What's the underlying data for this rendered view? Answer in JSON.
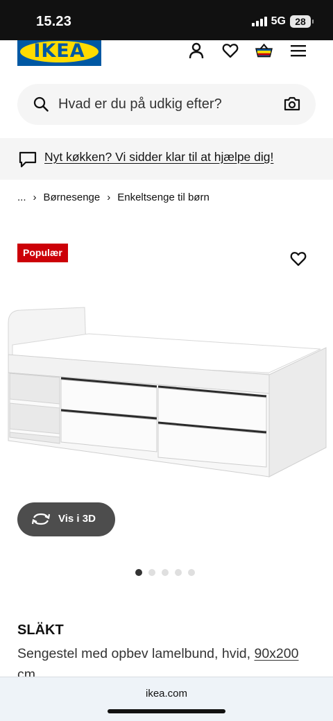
{
  "status_bar": {
    "time": "15.23",
    "network": "5G",
    "battery": "28"
  },
  "header": {
    "logo_text": "IKEA",
    "icons": [
      "user-icon",
      "heart-icon",
      "basket-icon",
      "menu-icon"
    ]
  },
  "search": {
    "placeholder": "Hvad er du på udkig efter?"
  },
  "banner": {
    "text": "Nyt køkken? Vi sidder klar til at hjælpe dig!"
  },
  "breadcrumb": {
    "items": [
      "...",
      "Børnesenge",
      "Enkeltsenge til børn"
    ]
  },
  "product": {
    "badge": "Populær",
    "view_3d_label": "Vis i 3D",
    "carousel": {
      "total": 5,
      "active": 1
    },
    "name": "SLÄKT",
    "description": "Sengestel med opbev lamelbund, hvid, ",
    "size": "90x200",
    "unit": "cm"
  },
  "browser": {
    "url": "ikea.com"
  },
  "colors": {
    "ikea_blue": "#0058a3",
    "ikea_yellow": "#ffdb00",
    "badge_red": "#cc0008"
  }
}
